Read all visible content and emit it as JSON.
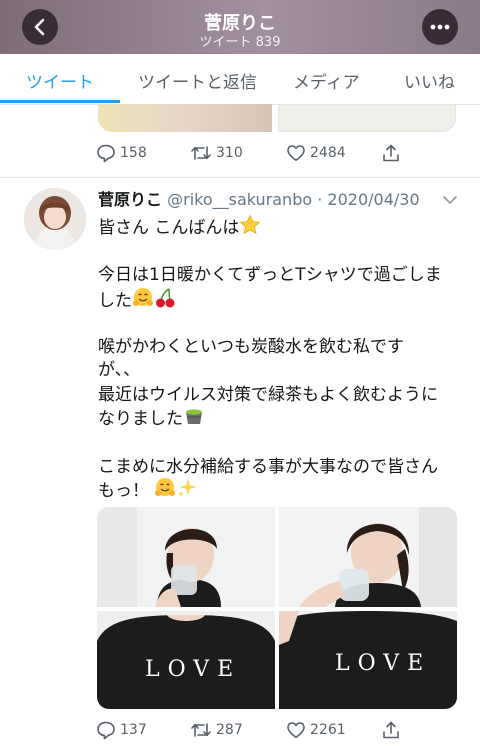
{
  "header": {
    "name": "菅原りこ",
    "tweet_count": "ツイート 839"
  },
  "tabs": [
    {
      "label": "ツイート"
    },
    {
      "label": "ツイートと返信"
    },
    {
      "label": "メディア"
    },
    {
      "label": "いいね"
    }
  ],
  "prev_tweet": {
    "replies": "158",
    "retweets": "310",
    "likes": "2484"
  },
  "tweet": {
    "display_name": "菅原りこ",
    "handle_date": "@riko__sakuranbo · 2020/04/30",
    "lines": [
      "皆さん こんばんは",
      "今日は1日暖かくてずっとTシャツで過ごしま",
      "した",
      "喉がかわくといつも炭酸水を飲む私です",
      "が、、",
      "最近はウイルス対策で緑茶もよく飲むように",
      "なりました",
      "こまめに水分補給する事が大事なので皆さん",
      "もっ！"
    ],
    "shirt_text": "LOVE",
    "replies": "137",
    "retweets": "287",
    "likes": "2261"
  },
  "icons": [
    "back-icon",
    "more-icon",
    "reply-icon",
    "retweet-icon",
    "like-icon",
    "share-icon",
    "chevron-down-icon",
    "star-emoji",
    "hug-emoji",
    "cherry-emoji",
    "tea-emoji",
    "sparkles-emoji"
  ],
  "colors": {
    "accent": "#1da1f2",
    "text": "#14171a",
    "muted": "#657786"
  }
}
